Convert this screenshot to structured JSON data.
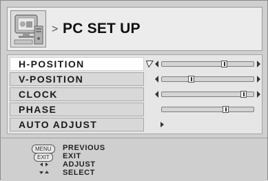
{
  "header": {
    "title": "PC SET UP",
    "breadcrumb_glyph": ">"
  },
  "menu": {
    "items": [
      {
        "label": "H-POSITION",
        "type": "slider",
        "value_pct": 69,
        "selected": true
      },
      {
        "label": "V-POSITION",
        "type": "slider",
        "value_pct": 31,
        "selected": false
      },
      {
        "label": "CLOCK",
        "type": "slider",
        "value_pct": 92,
        "selected": false
      },
      {
        "label": "PHASE",
        "type": "slider",
        "value_pct": 71,
        "selected": false
      },
      {
        "label": "AUTO ADJUST",
        "type": "action",
        "selected": false
      }
    ]
  },
  "footer": {
    "hints": [
      {
        "key": "MENU",
        "label": "PREVIOUS"
      },
      {
        "key": "EXIT",
        "label": "EXIT"
      },
      {
        "key": "left-right-arrows-icon",
        "label": "ADJUST"
      },
      {
        "key": "down-up-arrows-icon",
        "label": "SELECT"
      }
    ]
  },
  "colors": {
    "panel": "#cfcfcf",
    "menu_bg": "#e6e6e6",
    "selected_row": "#ffffff",
    "text": "#1a1a1a"
  }
}
